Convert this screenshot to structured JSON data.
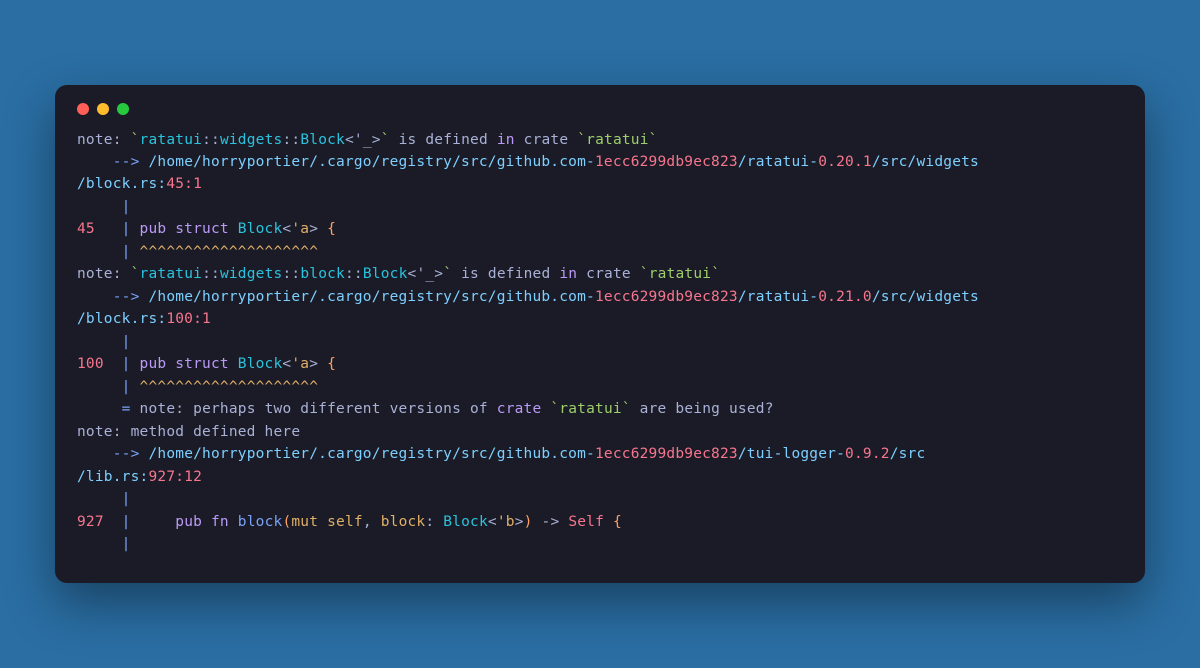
{
  "colors": {
    "bg": "#2a6ea3",
    "terminal": "#1a1b26"
  },
  "t": {
    "note": "note",
    "colon": ": ",
    "bt": "`",
    "is_defined": " is defined ",
    "in": "in",
    "crate": " crate ",
    "arrow": "    --> ",
    "path_prefix": "/home/horryportier/.cargo/registry/src/github.com-",
    "hash": "1ecc6299db9ec823",
    "ratatui_pkg": "/ratatui-",
    "v020": "0.20.1",
    "v021": "0.21.0",
    "src_widgets": "/src/widgets",
    "block_rs": "/block.rs:",
    "pos451": "45:1",
    "pos1001": "100:1",
    "pipe_only": "     |",
    "ln45": "45",
    "ln100": "100",
    "ln927": "927",
    "pipe_gap": "   | ",
    "pipe_gap2": "  | ",
    "pub_struct": "pub struct ",
    "Block": "Block",
    "lt": "<",
    "tick_a": "'a",
    "gt": ">",
    "brace_open": " {",
    "carets_pad": "     | ",
    "carets": "^^^^^^^^^^^^^^^^^^^^",
    "type1a": "ratatui",
    "type1b": "::",
    "type1c": "widgets",
    "type1d": "Block",
    "type1e": "<'_>",
    "type2_block": "block",
    "eq_note": "     = ",
    "perhaps1": "perhaps two different versions of ",
    "perhaps_crate": "crate ",
    "perhaps_tail": " are being used?",
    "method_defined": ": method defined here",
    "tui_pkg": "/tui-logger-",
    "v092": "0.9.2",
    "src": "/src",
    "lib_rs": "/lib.rs:",
    "pos92712": "927:12",
    "fn_pad": "    ",
    "pub_fn": "pub fn ",
    "block_fn": "block",
    "paren_o": "(",
    "mut_self": "mut self",
    "comma_sp": ", ",
    "block_param": "block",
    "colon_t": ": ",
    "tick_b": "'b",
    "paren_c": ")",
    "arrow_ret": " -> ",
    "Self": "Self",
    "ratatui_bt": "ratatui"
  }
}
